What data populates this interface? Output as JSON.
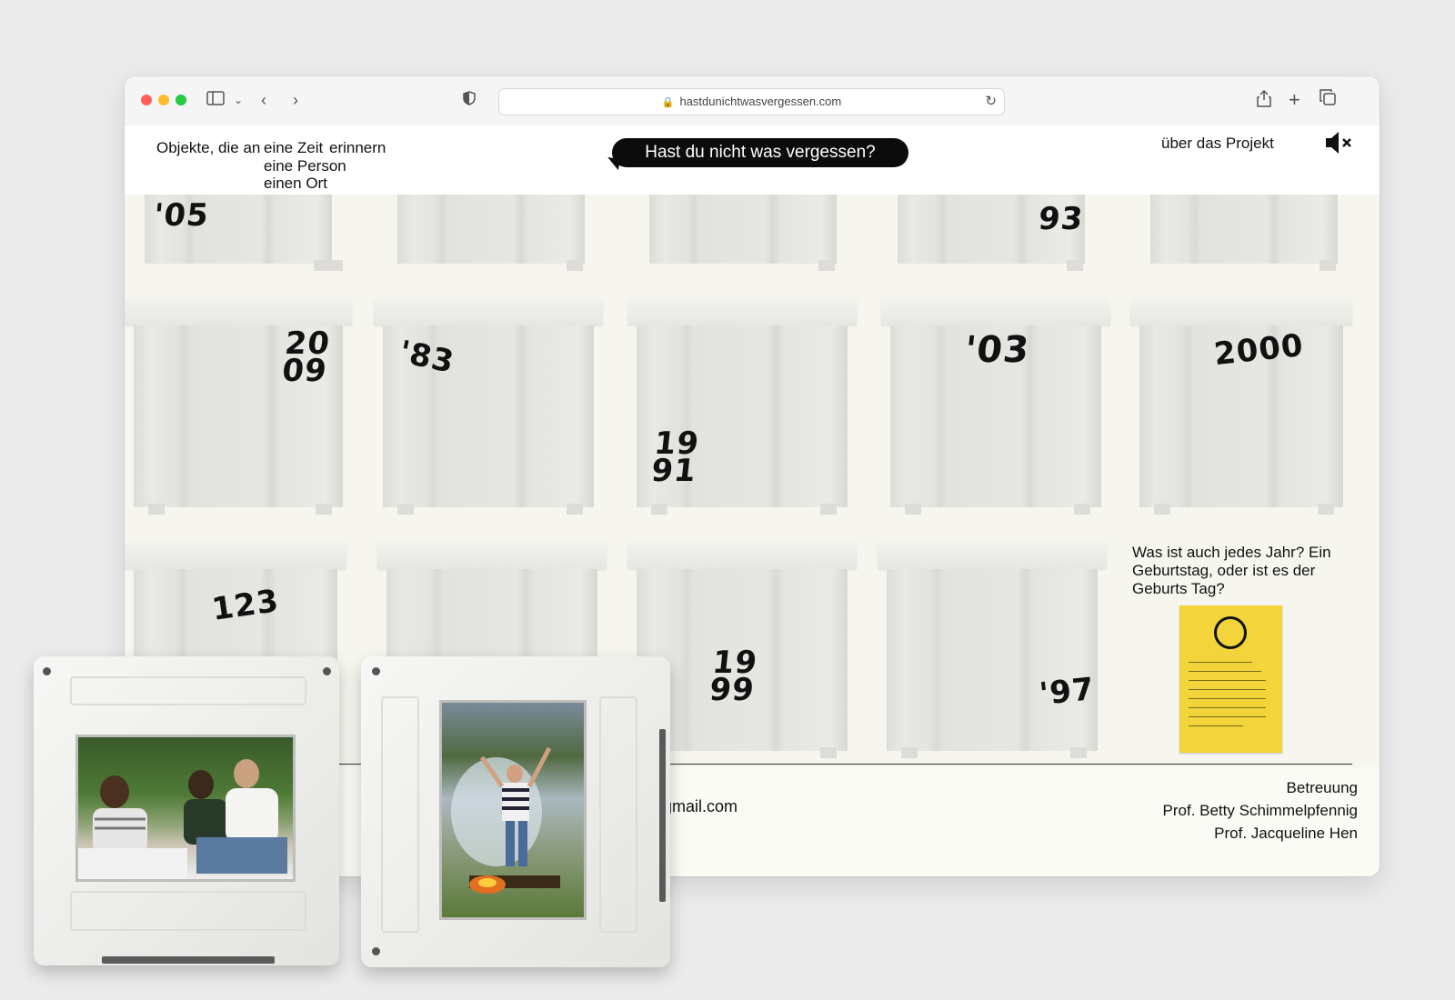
{
  "browser": {
    "url": "hastdunichtwasvergessen.com",
    "traffic_lights": [
      "#ff5f57",
      "#febc2e",
      "#28c840"
    ],
    "icons": [
      "sidebar-icon",
      "chevron-down-icon",
      "back-icon",
      "forward-icon",
      "shield-icon",
      "lock-icon",
      "reload-icon",
      "share-icon",
      "new-tab-icon",
      "tabs-icon"
    ]
  },
  "header": {
    "tagline_prefix": "Objekte, die an",
    "tagline_items": [
      "eine Zeit",
      "eine Person",
      "einen Ort"
    ],
    "tagline_suffix": "erinnern",
    "title": "Hast du nicht was vergessen?",
    "about": "über das Projekt",
    "mute_icon": "speaker-mute-icon"
  },
  "drawers": {
    "labels": [
      "'05",
      "93",
      "20\n09",
      "'83",
      "19\n91",
      "'03",
      "2000",
      "123",
      "19\n99",
      "'97"
    ]
  },
  "side": {
    "question": "Was ist auch jedes Jahr? Ein Geburtstag, oder ist es der Geburts Tag?"
  },
  "footer": {
    "email_fragment": "gmail.com",
    "credits_title": "Betreuung",
    "credits_names": [
      "Prof. Betty Schimmelpfennig",
      "Prof. Jacqueline Hen"
    ]
  },
  "colors": {
    "accent_bubble": "#0c0c0c",
    "card_yellow": "#f3d43a",
    "page_bg": "#fbfbf5"
  }
}
